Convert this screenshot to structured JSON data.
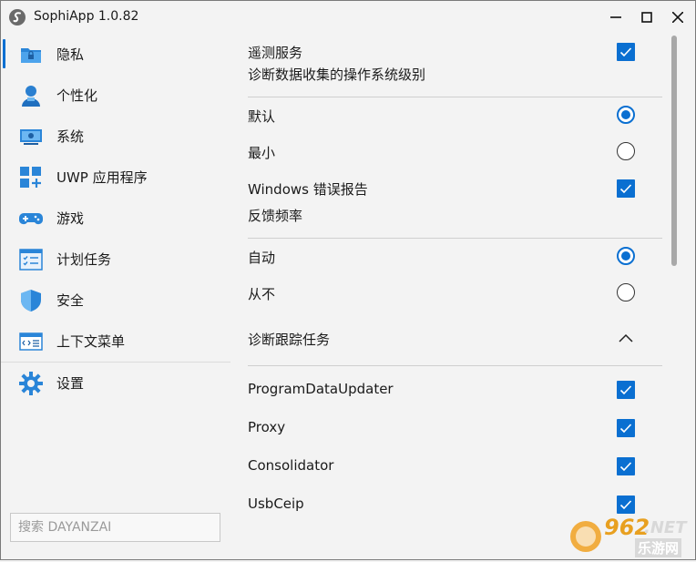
{
  "window": {
    "title": "SophiApp 1.0.82",
    "controls": {
      "minimize": "minimize",
      "maximize": "maximize",
      "close": "close"
    }
  },
  "sidebar": {
    "items": [
      {
        "label": "隐私",
        "icon": "privacy-folder-icon",
        "active": true
      },
      {
        "label": "个性化",
        "icon": "personalization-user-icon"
      },
      {
        "label": "系统",
        "icon": "system-monitor-icon"
      },
      {
        "label": "UWP 应用程序",
        "icon": "uwp-apps-icon"
      },
      {
        "label": "游戏",
        "icon": "gamepad-icon"
      },
      {
        "label": "计划任务",
        "icon": "scheduled-tasks-icon"
      },
      {
        "label": "安全",
        "icon": "shield-icon"
      },
      {
        "label": "上下文菜单",
        "icon": "context-menu-icon"
      },
      {
        "label": "设置",
        "icon": "gear-icon"
      }
    ],
    "search_placeholder": "搜索 DAYANZAI"
  },
  "content": {
    "telemetry": {
      "label": "遥测服务",
      "checked": true
    },
    "diag_level_heading": "诊断数据收集的操作系统级别",
    "diag_options": [
      {
        "label": "默认",
        "selected": true
      },
      {
        "label": "最小",
        "selected": false
      }
    ],
    "error_report": {
      "label": "Windows 错误报告",
      "checked": true
    },
    "feedback_heading": "反馈频率",
    "feedback_options": [
      {
        "label": "自动",
        "selected": true
      },
      {
        "label": "从不",
        "selected": false
      }
    ],
    "tracing_section": {
      "label": "诊断跟踪任务",
      "expanded": true
    },
    "tasks": [
      {
        "label": "ProgramDataUpdater",
        "checked": true
      },
      {
        "label": "Proxy",
        "checked": true
      },
      {
        "label": "Consolidator",
        "checked": true
      },
      {
        "label": "UsbCeip",
        "checked": true
      }
    ]
  },
  "watermark": {
    "number": "962",
    "suffix": ".NET",
    "sub": "乐游网"
  },
  "colors": {
    "accent": "#0a6fd1",
    "background": "#f3f3f3"
  }
}
